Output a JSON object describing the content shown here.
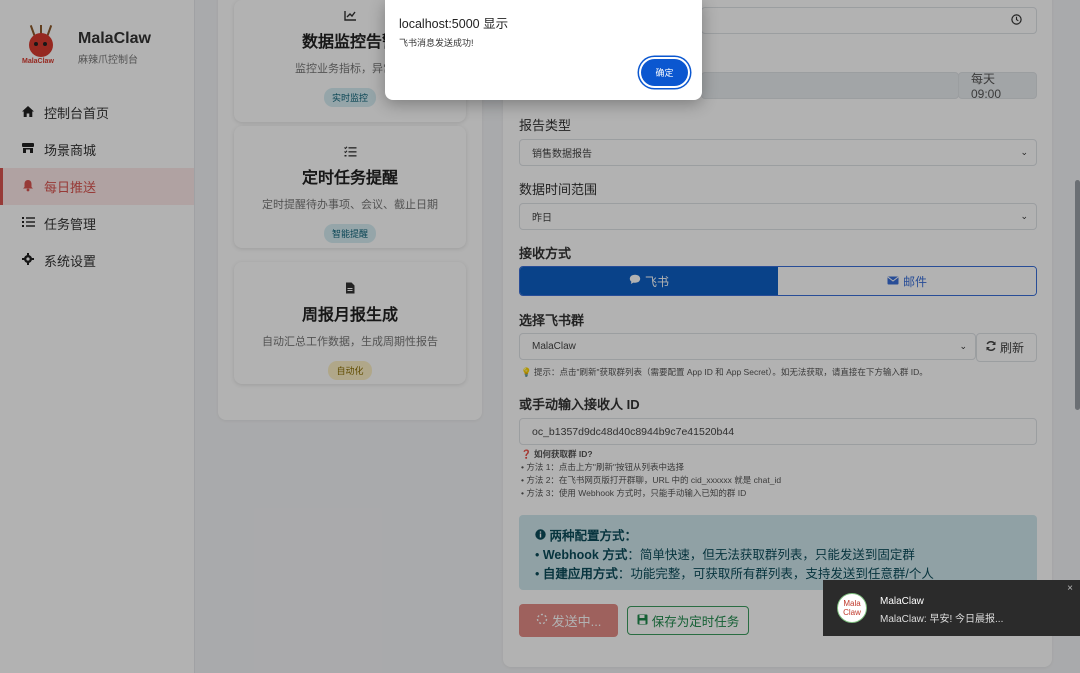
{
  "sidebar": {
    "brand_name": "MalaClaw",
    "brand_sub": "麻辣爪控制台",
    "logo_text": "MalaClaw",
    "items": [
      {
        "label": "控制台首页",
        "icon": "home-icon"
      },
      {
        "label": "场景商城",
        "icon": "store-icon"
      },
      {
        "label": "每日推送",
        "icon": "bell-icon"
      },
      {
        "label": "任务管理",
        "icon": "list-icon"
      },
      {
        "label": "系统设置",
        "icon": "gear-icon"
      }
    ]
  },
  "features": [
    {
      "title": "数据监控告警",
      "desc": "监控业务指标，异常时",
      "badge": "实时监控",
      "icon": "chart-icon"
    },
    {
      "title": "定时任务提醒",
      "desc": "定时提醒待办事项、会议、截止日期",
      "badge": "智能提醒",
      "icon": "tasks-icon"
    },
    {
      "title": "周报月报生成",
      "desc": "自动汇总工作数据，生成周期性报告",
      "badge": "自动化",
      "icon": "file-icon"
    }
  ],
  "form": {
    "schedule_suffix": "每天 09:00",
    "report_type_label": "报告类型",
    "report_type_value": "销售数据报告",
    "time_range_label": "数据时间范围",
    "time_range_value": "昨日",
    "receive_label": "接收方式",
    "receive_options": [
      "飞书",
      "邮件"
    ],
    "group_label": "选择飞书群",
    "group_value": "MalaClaw",
    "refresh_label": "刷新",
    "group_hint": "提示：点击\"刷新\"获取群列表（需要配置 App ID 和 App Secret）。如无法获取，请直接在下方输入群 ID。",
    "manual_label": "或手动输入接收人 ID",
    "manual_value": "oc_b1357d9dc48d40c8944b9c7e41520b44",
    "howto_title": "如何获取群 ID?",
    "howto_lines": [
      "• 方法 1：点击上方\"刷新\"按钮从列表中选择",
      "• 方法 2：在飞书网页版打开群聊，URL 中的 cid_xxxxxx 就是 chat_id",
      "• 方法 3：使用 Webhook 方式时，只能手动输入已知的群 ID"
    ],
    "info_title": "两种配置方式：",
    "info_line1_key": "Webhook 方式",
    "info_line1_val": "：简单快速，但无法获取群列表，只能发送到固定群",
    "info_line2_key": "自建应用方式",
    "info_line2_val": "：功能完整，可获取所有群列表，支持发送到任意群/个人",
    "send_label": "发送中...",
    "save_label": "保存为定时任务"
  },
  "dialog": {
    "title": "localhost:5000 显示",
    "message": "飞书消息发送成功!",
    "ok_label": "确定"
  },
  "toast": {
    "avatar_text": "Mala Claw",
    "title": "MalaClaw",
    "body": "MalaClaw: 早安! 今日晨报...",
    "close": "×"
  }
}
